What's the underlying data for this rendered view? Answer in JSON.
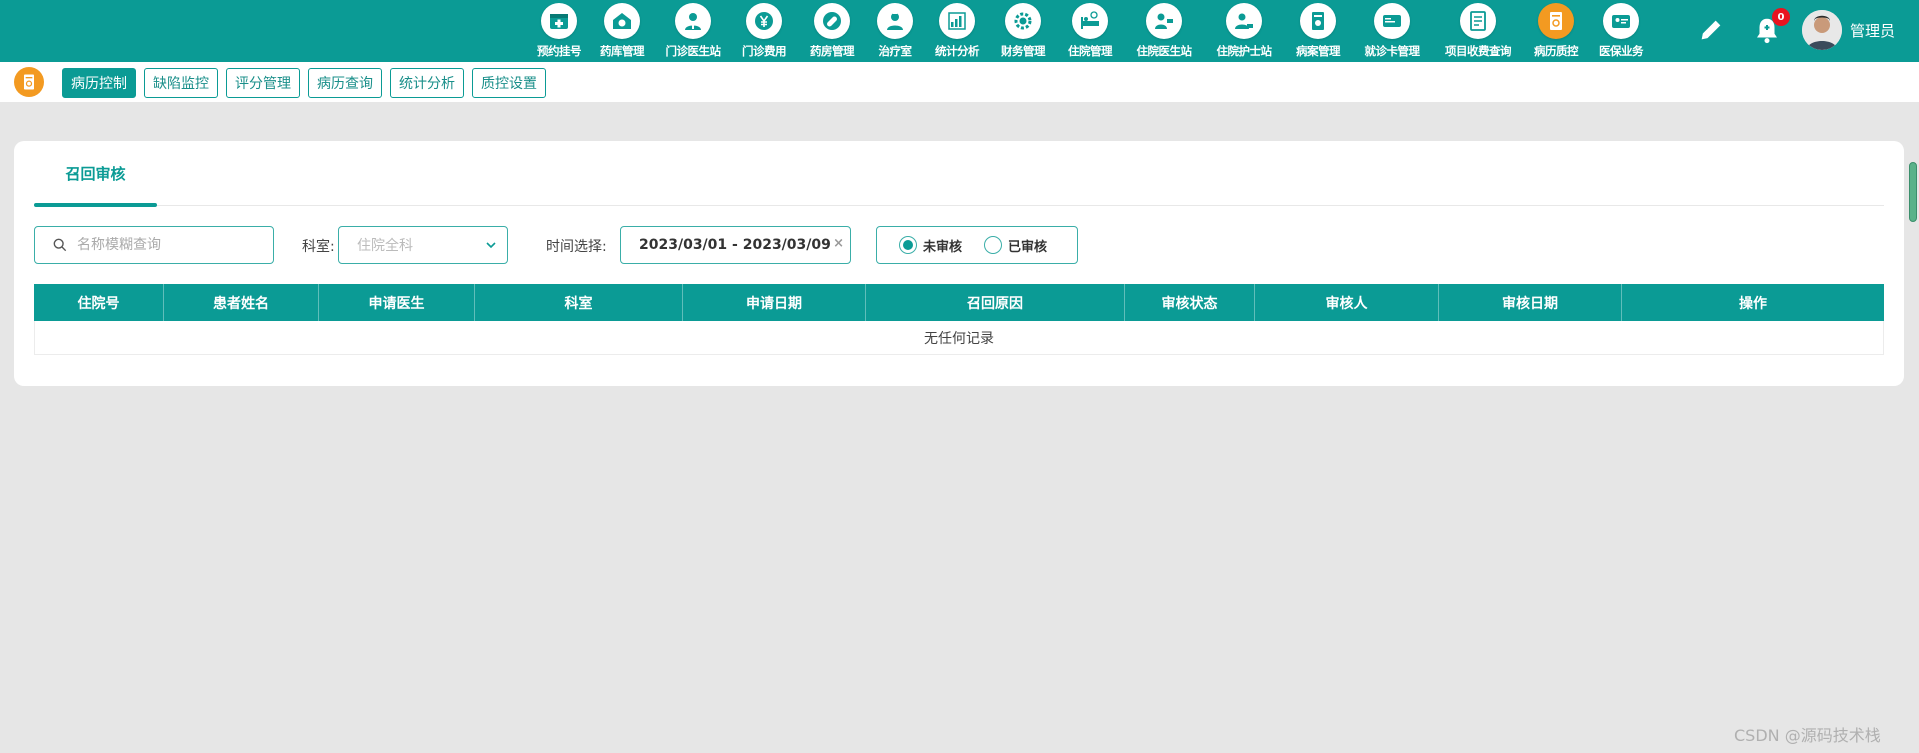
{
  "header": {
    "nav_items": [
      {
        "label": "预约挂号",
        "icon": "calendar-plus-icon"
      },
      {
        "label": "药库管理",
        "icon": "warehouse-pill-icon"
      },
      {
        "label": "门诊医生站",
        "icon": "doctor-icon"
      },
      {
        "label": "门诊费用",
        "icon": "yuan-icon"
      },
      {
        "label": "药房管理",
        "icon": "pill-icon"
      },
      {
        "label": "治疗室",
        "icon": "nurse-icon"
      },
      {
        "label": "统计分析",
        "icon": "bar-chart-icon"
      },
      {
        "label": "财务管理",
        "icon": "finance-gear-icon"
      },
      {
        "label": "住院管理",
        "icon": "hospital-bed-icon"
      },
      {
        "label": "住院医生站",
        "icon": "inpatient-doctor-icon"
      },
      {
        "label": "住院护士站",
        "icon": "inpatient-nurse-icon"
      },
      {
        "label": "病案管理",
        "icon": "medical-record-icon"
      },
      {
        "label": "就诊卡管理",
        "icon": "card-icon"
      },
      {
        "label": "项目收费查询",
        "icon": "fee-query-icon"
      },
      {
        "label": "病历质控",
        "icon": "record-quality-icon",
        "active": true
      },
      {
        "label": "医保业务",
        "icon": "insurance-card-icon"
      }
    ],
    "notification_count": "0",
    "user_name": "管理员"
  },
  "subnav": {
    "tabs": [
      {
        "label": "病历控制",
        "active": true
      },
      {
        "label": "缺陷监控"
      },
      {
        "label": "评分管理"
      },
      {
        "label": "病历查询"
      },
      {
        "label": "统计分析"
      },
      {
        "label": "质控设置"
      }
    ]
  },
  "panel": {
    "tab_label": "召回审核",
    "search_placeholder": "名称模糊查询",
    "dept_label": "科室:",
    "dept_placeholder": "住院全科",
    "time_label": "时间选择:",
    "date_range": "2023/03/01 - 2023/03/09",
    "date_clear": "×",
    "radios": [
      {
        "label": "未审核",
        "checked": true
      },
      {
        "label": "已审核",
        "checked": false
      }
    ]
  },
  "table": {
    "columns": [
      {
        "label": "住院号"
      },
      {
        "label": "患者姓名"
      },
      {
        "label": "申请医生"
      },
      {
        "label": "科室"
      },
      {
        "label": "申请日期"
      },
      {
        "label": "召回原因"
      },
      {
        "label": "审核状态"
      },
      {
        "label": "审核人"
      },
      {
        "label": "审核日期"
      },
      {
        "label": "操作"
      }
    ],
    "empty_text": "无任何记录"
  },
  "watermark": "CSDN @源码技术栈",
  "colors": {
    "primary": "#0b9b95",
    "accent": "#f39a21",
    "badge": "#e8141f"
  }
}
